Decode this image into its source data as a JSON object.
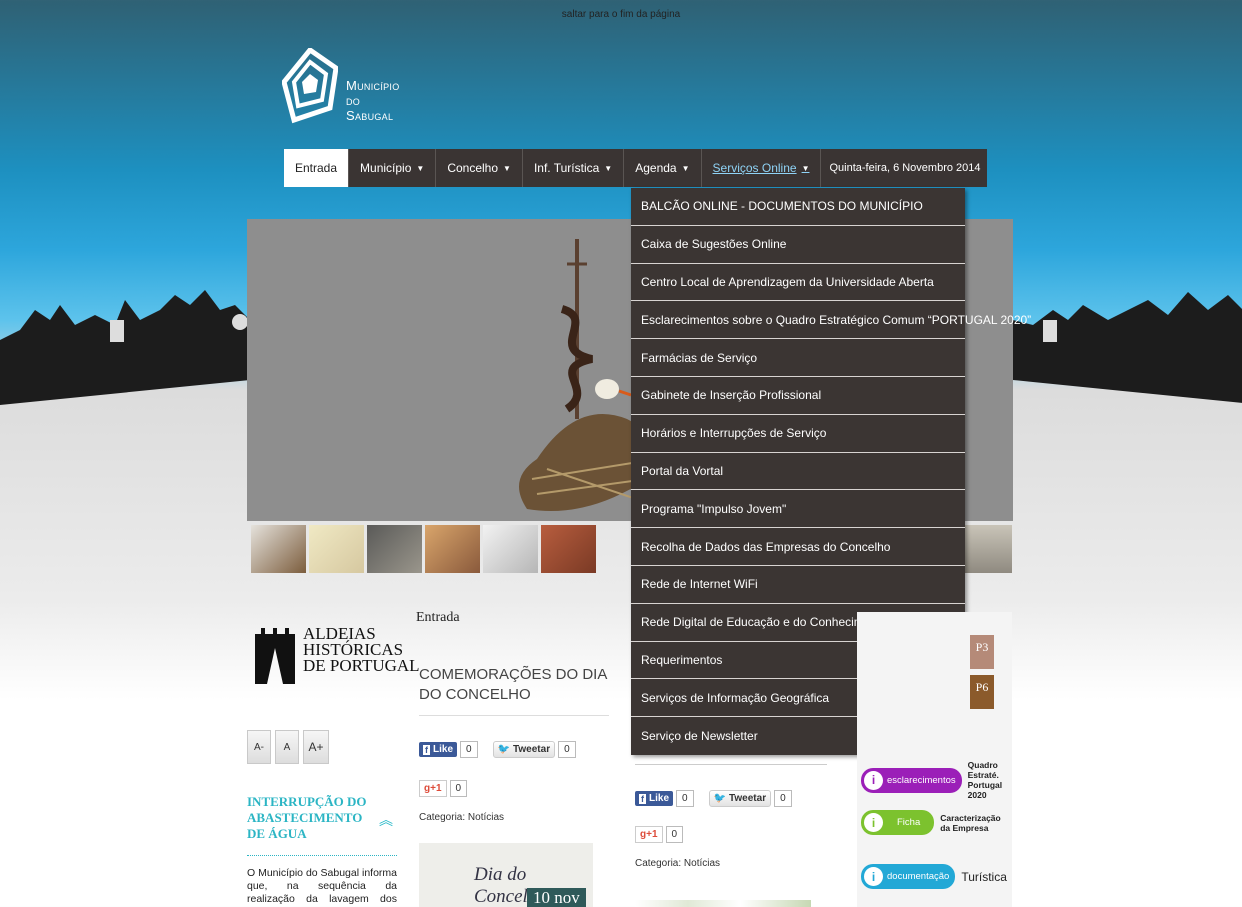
{
  "skip_link": "saltar para o fim da página",
  "logo": {
    "line1": "Município",
    "line2": "do",
    "line3": "Sabugal"
  },
  "nav": {
    "items": [
      {
        "label": "Entrada",
        "active": true
      },
      {
        "label": "Município",
        "dropdown": true
      },
      {
        "label": "Concelho",
        "dropdown": true
      },
      {
        "label": "Inf. Turística",
        "dropdown": true
      },
      {
        "label": "Agenda",
        "dropdown": true
      },
      {
        "label": "Serviços Online",
        "dropdown": true,
        "open": true
      }
    ],
    "date": "Quinta-feira, 6 Novembro 2014"
  },
  "dropdown": {
    "items": [
      "BALCÃO ONLINE - DOCUMENTOS DO MUNICÍPIO",
      "Caixa de Sugestões Online",
      "Centro Local de Aprendizagem da Universidade Aberta",
      "Esclarecimentos sobre o Quadro Estratégico Comum “PORTUGAL 2020”",
      "Farmácias de Serviço",
      "Gabinete de Inserção Profissional",
      "Horários e Interrupções de Serviço",
      "Portal da Vortal",
      "Programa \"Impulso Jovem\"",
      "Recolha de Dados das Empresas do Concelho",
      "Rede de Internet WiFi",
      "Rede Digital de Educação e do Conhecimento",
      "Requerimentos",
      "Serviços de Informação Geográfica",
      "Serviço de Newsletter"
    ]
  },
  "aldeias": {
    "line1": "ALDEIAS",
    "line2": "HISTÓRICAS",
    "line3": "DE PORTUGAL"
  },
  "font_buttons": {
    "small": "A-",
    "normal": "A",
    "large": "A+"
  },
  "interrupt": {
    "title": "INTERRUPÇÃO DO ABASTECIMENTO DE ÁGUA",
    "body": "O Município do Sabugal informa que, na sequência da realização da lavagem dos reservatórios de água"
  },
  "breadcrumb": "Entrada",
  "article": {
    "title": "COMEMORAÇÕES DO DIA DO CONCELHO",
    "category": "Categoria: Notícias",
    "image_text": "Dia do Concelho",
    "image_date": "10 nov"
  },
  "social": {
    "like": "Like",
    "like_count": "0",
    "tweet": "Tweetar",
    "tweet_count": "0",
    "gplus": "+1",
    "gplus_count": "0"
  },
  "article2": {
    "category": "Categoria: Notícias"
  },
  "right_panel": {
    "badge1": "P3",
    "badge2": "P6",
    "esclarecimentos": "esclarecimentos",
    "esclarecimentos_side": "Quadro Estraté. Portugal 2020",
    "ficha": "Ficha",
    "ficha_side": "Caracterização da Empresa",
    "documentacao": "documentação",
    "documentacao_side": "Turística"
  },
  "colors": {
    "nav_bg": "#3a3433",
    "dropdown_bg": "#3b3533",
    "link_active": "#8fd3f6",
    "accent_teal": "#2bb5c4",
    "purple": "#9b1fb8",
    "green": "#7cc22e",
    "cyan": "#22a8d6"
  }
}
